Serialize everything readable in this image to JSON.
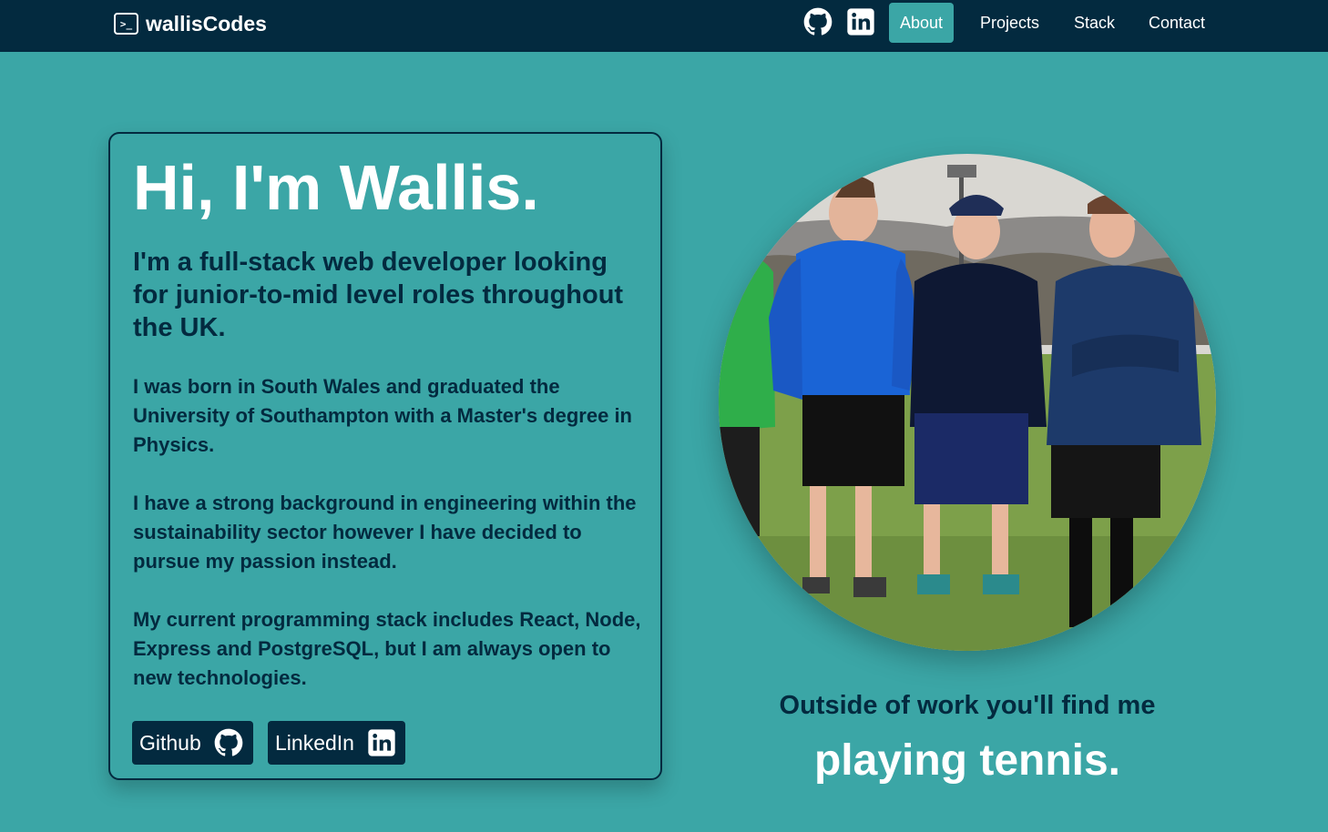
{
  "nav": {
    "brand": "wallisCodes",
    "brand_icon": ">_",
    "icons": [
      "github-icon",
      "linkedin-icon"
    ],
    "links": [
      {
        "label": "About",
        "active": true
      },
      {
        "label": "Projects",
        "active": false
      },
      {
        "label": "Stack",
        "active": false
      },
      {
        "label": "Contact",
        "active": false
      }
    ]
  },
  "about": {
    "title": "Hi, I'm Wallis.",
    "subtitle": "I'm a full-stack web developer looking for junior-to-mid level roles throughout the UK.",
    "paragraphs": [
      "I was born in South Wales and graduated the University of Southampton with a Master's degree in Physics.",
      "I have a strong background in engineering within the sustainability sector however I have decided to pursue my passion instead.",
      "My current programming stack includes React, Node, Express and PostgreSQL, but I am always open to new technologies."
    ],
    "buttons": {
      "github": "Github",
      "linkedin": "LinkedIn"
    }
  },
  "photo_section": {
    "tagline": "Outside of work you'll find me",
    "tagline_strong": "playing tennis."
  },
  "colors": {
    "background": "#3ba6a6",
    "navbar": "#032a3f",
    "text_dark": "#032a3f",
    "text_light": "#ffffff"
  }
}
